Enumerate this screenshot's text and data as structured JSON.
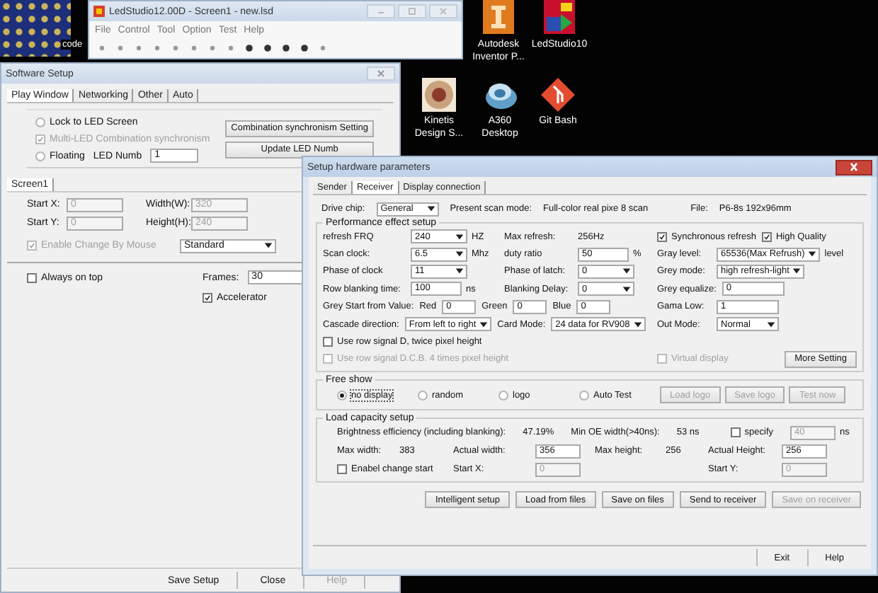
{
  "desktop": {
    "partial_label": "code",
    "icons": [
      {
        "label": "Autodesk Inventor P..."
      },
      {
        "label": "LedStudio10"
      },
      {
        "label": "Kinetis Design S..."
      },
      {
        "label": "A360 Desktop"
      },
      {
        "label": "Git Bash"
      }
    ]
  },
  "main_window": {
    "title": "LedStudio12.00D - Screen1 - new.lsd",
    "menu": [
      "File",
      "Control",
      "Tool",
      "Option",
      "Test",
      "Help"
    ]
  },
  "software_setup": {
    "title": "Software Setup",
    "tabs": [
      {
        "label": "Play Window",
        "selected": true
      },
      {
        "label": "Networking",
        "selected": false
      },
      {
        "label": "Other",
        "selected": false
      },
      {
        "label": "Auto",
        "selected": false
      }
    ],
    "lock_rows": [
      [
        {
          "kind": "radio",
          "label": "Lock to LED Screen",
          "selected": false
        }
      ],
      [
        {
          "kind": "check",
          "label": "Multi-LED Combination synchronism",
          "checked": true,
          "disabled": true
        }
      ],
      [
        {
          "kind": "radio",
          "label": "Floating",
          "selected": false
        },
        {
          "kind": "label",
          "text": "LED Numb"
        },
        {
          "kind": "input",
          "value": "1"
        }
      ]
    ],
    "lock_buttons": [
      {
        "kind": "button",
        "label": "Combination synchronism Setting"
      },
      {
        "kind": "button",
        "label": "Update LED Numb"
      }
    ],
    "screen_tab": "Screen1",
    "screen_rows": [
      [
        {
          "kind": "label",
          "text": "Start X:"
        },
        {
          "kind": "input",
          "value": "0",
          "disabled": true
        },
        {
          "kind": "label",
          "text": "Width(W):"
        },
        {
          "kind": "input",
          "value": "320",
          "disabled": true
        }
      ],
      [
        {
          "kind": "label",
          "text": "Start Y:"
        },
        {
          "kind": "input",
          "value": "0",
          "disabled": true
        },
        {
          "kind": "label",
          "text": "Height(H):"
        },
        {
          "kind": "input",
          "value": "240",
          "disabled": true
        }
      ],
      [
        {
          "kind": "check",
          "label": "Enable Change By Mouse",
          "checked": true,
          "disabled": true
        },
        {
          "kind": "select",
          "value": "Standard"
        }
      ]
    ],
    "option_rows": [
      [
        {
          "kind": "check",
          "label": "Always on top",
          "checked": false
        },
        {
          "kind": "label",
          "text": "Frames:"
        },
        {
          "kind": "input",
          "value": "30"
        }
      ],
      [
        {
          "kind": "check",
          "label": "Accelerator",
          "checked": true
        }
      ]
    ],
    "buttons": [
      {
        "kind": "button",
        "label": "Save Setup"
      },
      {
        "kind": "button",
        "label": "Close"
      },
      {
        "kind": "button",
        "label": "Help",
        "disabled": true
      }
    ]
  },
  "hardware_setup": {
    "title": "Setup hardware parameters",
    "tabs": [
      {
        "label": "Sender",
        "selected": false
      },
      {
        "label": "Receiver",
        "selected": true
      },
      {
        "label": "Display connection",
        "selected": false
      }
    ],
    "header": [
      {
        "kind": "label",
        "text": "Drive chip:"
      },
      {
        "kind": "select",
        "value": "General"
      },
      {
        "kind": "label",
        "text": "Present scan mode:"
      },
      {
        "kind": "value",
        "text": "Full-color real pixe 8 scan"
      },
      {
        "kind": "label",
        "text": "File:"
      },
      {
        "kind": "value",
        "text": "P6-8s 192x96mm"
      }
    ],
    "performance": {
      "title": "Performance effect setup",
      "rows": [
        {
          "left": [
            {
              "kind": "label",
              "text": "refresh FRQ"
            },
            {
              "kind": "select",
              "value": "240",
              "unit": "HZ"
            },
            {
              "kind": "label",
              "text": "Max refresh:"
            },
            {
              "kind": "value",
              "text": "256Hz"
            }
          ],
          "right": [
            {
              "kind": "check",
              "label": "Synchronous refresh",
              "checked": true
            },
            {
              "kind": "check",
              "label": "High Quality",
              "checked": true
            }
          ]
        },
        {
          "left": [
            {
              "kind": "label",
              "text": "Scan clock:"
            },
            {
              "kind": "select",
              "value": "6.5",
              "unit": "Mhz"
            },
            {
              "kind": "label",
              "text": "duty ratio"
            },
            {
              "kind": "input",
              "value": "50",
              "unit": "%"
            }
          ],
          "right": [
            {
              "kind": "label",
              "text": "Gray level:"
            },
            {
              "kind": "select",
              "value": "65536(Max Refrush)",
              "unit": "level"
            }
          ]
        },
        {
          "left": [
            {
              "kind": "label",
              "text": "Phase of clock"
            },
            {
              "kind": "select",
              "value": "11"
            },
            {
              "kind": "label",
              "text": "Phase of latch:"
            },
            {
              "kind": "select",
              "value": "0"
            }
          ],
          "right": [
            {
              "kind": "label",
              "text": "Grey mode:"
            },
            {
              "kind": "select",
              "value": "high refresh-light"
            }
          ]
        },
        {
          "left": [
            {
              "kind": "label",
              "text": "Row blanking time:"
            },
            {
              "kind": "input",
              "value": "100",
              "unit": "ns"
            },
            {
              "kind": "label",
              "text": "Blanking Delay:"
            },
            {
              "kind": "select",
              "value": "0"
            }
          ],
          "right": [
            {
              "kind": "label",
              "text": "Grey equalize:"
            },
            {
              "kind": "input",
              "value": "0"
            }
          ]
        },
        {
          "left": [
            {
              "kind": "label",
              "text": "Grey Start from Value:"
            },
            {
              "kind": "label",
              "text": "Red"
            },
            {
              "kind": "input",
              "value": "0"
            },
            {
              "kind": "label",
              "text": "Green"
            },
            {
              "kind": "input",
              "value": "0"
            },
            {
              "kind": "label",
              "text": "Blue"
            },
            {
              "kind": "input",
              "value": "0"
            }
          ],
          "right": [
            {
              "kind": "label",
              "text": "Gama Low:"
            },
            {
              "kind": "input",
              "value": "1"
            }
          ]
        },
        {
          "left": [
            {
              "kind": "label",
              "text": "Cascade direction:"
            },
            {
              "kind": "select",
              "value": "From left to right"
            },
            {
              "kind": "label",
              "text": "Card Mode:"
            },
            {
              "kind": "select",
              "value": "24 data for RV908"
            }
          ],
          "right": [
            {
              "kind": "label",
              "text": "Out Mode:"
            },
            {
              "kind": "select",
              "value": "Normal"
            }
          ]
        },
        {
          "left": [
            {
              "kind": "check",
              "label": "Use row signal D, twice pixel height",
              "checked": false
            }
          ],
          "right": []
        },
        {
          "left": [
            {
              "kind": "check",
              "label": "Use row signal D.C.B. 4 times pixel height",
              "checked": false,
              "disabled": true
            }
          ],
          "right": [
            {
              "kind": "check",
              "label": "Virtual display",
              "checked": false,
              "disabled": true
            },
            {
              "kind": "button",
              "label": "More Setting"
            }
          ]
        }
      ]
    },
    "free_show": {
      "title": "Free show",
      "items": [
        {
          "kind": "radio",
          "label": "no display",
          "selected": true
        },
        {
          "kind": "radio",
          "label": "random",
          "selected": false
        },
        {
          "kind": "radio",
          "label": "logo",
          "selected": false
        },
        {
          "kind": "radio",
          "label": "Auto Test",
          "selected": false
        },
        {
          "kind": "button",
          "label": "Load logo",
          "disabled": true
        },
        {
          "kind": "button",
          "label": "Save logo",
          "disabled": true
        },
        {
          "kind": "button",
          "label": "Test now",
          "disabled": true
        }
      ]
    },
    "load_capacity": {
      "title": "Load capacity setup",
      "summary": [
        {
          "kind": "label",
          "text": "Brightness efficiency (including blanking):"
        },
        {
          "kind": "value",
          "text": "47.19%"
        },
        {
          "kind": "label",
          "text": "Min OE width(>40ns):"
        },
        {
          "kind": "value",
          "text": "53 ns"
        },
        {
          "kind": "check",
          "label": "specify",
          "checked": false
        },
        {
          "kind": "input",
          "value": "40",
          "unit": "ns",
          "disabled": true
        }
      ],
      "sizes": [
        {
          "kind": "label",
          "text": "Max width:"
        },
        {
          "kind": "value",
          "text": "383"
        },
        {
          "kind": "label",
          "text": "Actual width:"
        },
        {
          "kind": "input",
          "value": "356"
        },
        {
          "kind": "label",
          "text": "Max height:"
        },
        {
          "kind": "value",
          "text": "256"
        },
        {
          "kind": "label",
          "text": "Actual Height:"
        },
        {
          "kind": "input",
          "value": "256"
        }
      ],
      "start": [
        {
          "kind": "check",
          "label": "Enabel change start",
          "checked": false
        },
        {
          "kind": "label",
          "text": "Start X:"
        },
        {
          "kind": "input",
          "value": "0",
          "disabled": true
        },
        {
          "kind": "label",
          "text": "Start Y:"
        },
        {
          "kind": "input",
          "value": "0",
          "disabled": true
        }
      ]
    },
    "actions": [
      {
        "kind": "button",
        "label": "Intelligent setup"
      },
      {
        "kind": "button",
        "label": "Load from files"
      },
      {
        "kind": "button",
        "label": "Save on files"
      },
      {
        "kind": "button",
        "label": "Send to receiver"
      },
      {
        "kind": "button",
        "label": "Save on receiver",
        "disabled": true
      }
    ],
    "footer": [
      {
        "kind": "button",
        "label": "Exit"
      },
      {
        "kind": "button",
        "label": "Help"
      }
    ]
  }
}
